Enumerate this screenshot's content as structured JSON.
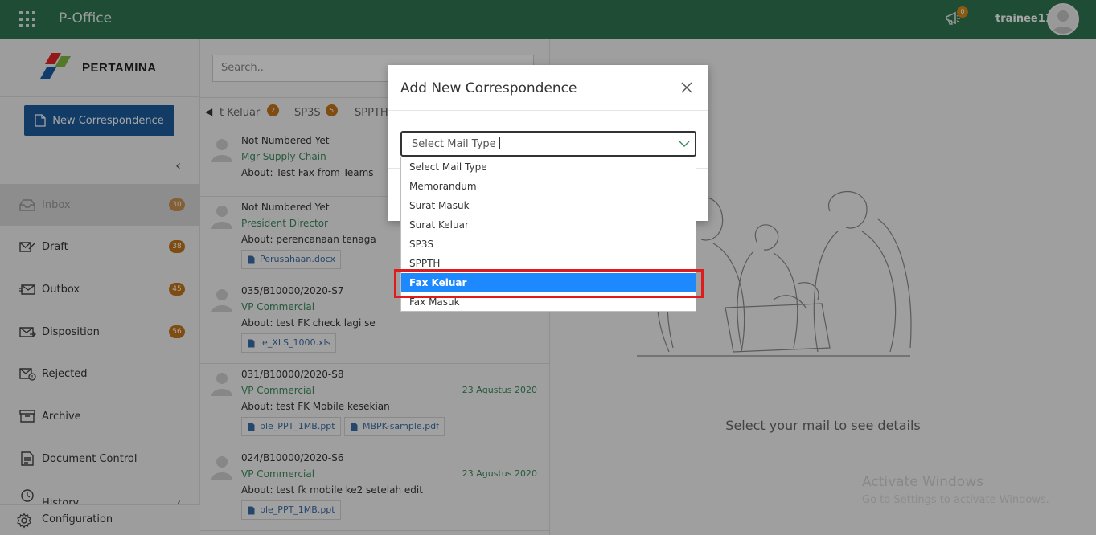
{
  "app": {
    "title": "P-Office",
    "notification_count": "0",
    "username": "trainee11"
  },
  "sidebar": {
    "brand": "PERTAMINA",
    "new_button": "New Correspondence",
    "items": [
      {
        "label": "Inbox",
        "badge": "30",
        "icon": "inbox-icon"
      },
      {
        "label": "Draft",
        "badge": "38",
        "icon": "draft-icon"
      },
      {
        "label": "Outbox",
        "badge": "45",
        "icon": "outbox-icon"
      },
      {
        "label": "Disposition",
        "badge": "56",
        "icon": "disposition-icon"
      },
      {
        "label": "Rejected",
        "badge": "",
        "icon": "rejected-icon"
      },
      {
        "label": "Archive",
        "badge": "",
        "icon": "archive-icon"
      },
      {
        "label": "Document Control",
        "badge": "",
        "icon": "document-control-icon"
      },
      {
        "label": "History",
        "badge": "",
        "icon": "history-icon"
      }
    ],
    "configuration": "Configuration"
  },
  "list": {
    "search_placeholder": "Search..",
    "tabs": [
      {
        "label": "t Keluar",
        "badge": "2"
      },
      {
        "label": "SP3S",
        "badge": "5"
      },
      {
        "label": "SPPTH",
        "badge": ""
      }
    ],
    "mails": [
      {
        "number": "Not Numbered Yet",
        "from": "Mgr Supply Chain",
        "about": "About: Test Fax from Teams",
        "date": "",
        "attachments": []
      },
      {
        "number": "Not Numbered Yet",
        "from": "President Director",
        "about": "About: perencanaan tenaga",
        "date": "",
        "attachments": [
          "Perusahaan.docx"
        ]
      },
      {
        "number": "035/B10000/2020-S7",
        "from": "VP Commercial",
        "about": "About: test FK check lagi se",
        "date": "",
        "attachments": [
          "le_XLS_1000.xls"
        ]
      },
      {
        "number": "031/B10000/2020-S8",
        "from": "VP Commercial",
        "about": "About: test FK Mobile kesekian",
        "date": "23 Agustus 2020",
        "attachments": [
          "ple_PPT_1MB.ppt",
          "MBPK-sample.pdf"
        ]
      },
      {
        "number": "024/B10000/2020-S6",
        "from": "VP Commercial",
        "about": "About: test fk mobile ke2 setelah edit",
        "date": "23 Agustus 2020",
        "attachments": [
          "ple_PPT_1MB.ppt"
        ]
      }
    ]
  },
  "detail": {
    "empty_text": "Select your mail to see details",
    "watermark_title": "Activate Windows",
    "watermark_sub": "Go to Settings to activate Windows."
  },
  "modal": {
    "title": "Add New Correspondence",
    "select_placeholder": "Select Mail Type",
    "options": [
      "Select Mail Type",
      "Memorandum",
      "Surat Masuk",
      "Surat Keluar",
      "SP3S",
      "SPPTH",
      "Fax Keluar",
      "Fax Masuk"
    ],
    "selected_option": "Fax Keluar"
  },
  "colors": {
    "topbar": "#2f7552",
    "primary_button": "#1c5c9b",
    "badge": "#c4761b",
    "selected_option": "#1e88ff",
    "highlight": "#e01b1b"
  }
}
